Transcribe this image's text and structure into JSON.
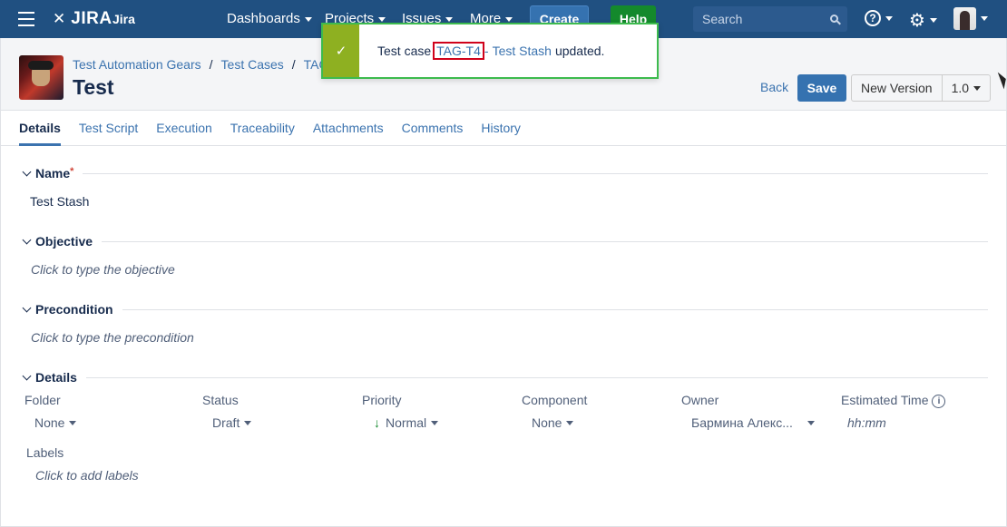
{
  "topnav": {
    "logo_text": "JIRA",
    "app_name": "Jira",
    "menu": [
      "Dashboards",
      "Projects",
      "Issues",
      "More"
    ],
    "create_label": "Create",
    "help_label": "Help",
    "search_placeholder": "Search",
    "help_icon": "?"
  },
  "header": {
    "breadcrumb": [
      "Test Automation Gears",
      "Test Cases",
      "TAG-T4"
    ],
    "title": "Test",
    "back_label": "Back",
    "save_label": "Save",
    "new_version_label": "New Version",
    "version_label": "1.0"
  },
  "tabs": [
    "Details",
    "Test Script",
    "Execution",
    "Traceability",
    "Attachments",
    "Comments",
    "History"
  ],
  "sections": {
    "name": {
      "title": "Name",
      "required_mark": "*",
      "value": "Test Stash"
    },
    "objective": {
      "title": "Objective",
      "placeholder": "Click to type the objective"
    },
    "precondition": {
      "title": "Precondition",
      "placeholder": "Click to type the precondition"
    },
    "details": {
      "title": "Details",
      "fields": [
        {
          "label": "Folder",
          "value": "None"
        },
        {
          "label": "Status",
          "value": "Draft"
        },
        {
          "label": "Priority",
          "value": "Normal"
        },
        {
          "label": "Component",
          "value": "None"
        },
        {
          "label": "Owner",
          "value": "Бармина Алекс..."
        },
        {
          "label": "Estimated Time",
          "value": "hh:mm"
        }
      ],
      "labels_label": "Labels",
      "labels_placeholder": "Click to add labels"
    }
  },
  "flag": {
    "prefix": "Test case",
    "key": "TAG-T4",
    "separator": "-",
    "name": "Test Stash",
    "suffix": "updated.",
    "check": "✓",
    "accent_color": "#8eb021"
  },
  "colors": {
    "nav_bg": "#205081",
    "link": "#3b73af",
    "primary_button": "#3572b0",
    "help_button": "#14892c"
  }
}
